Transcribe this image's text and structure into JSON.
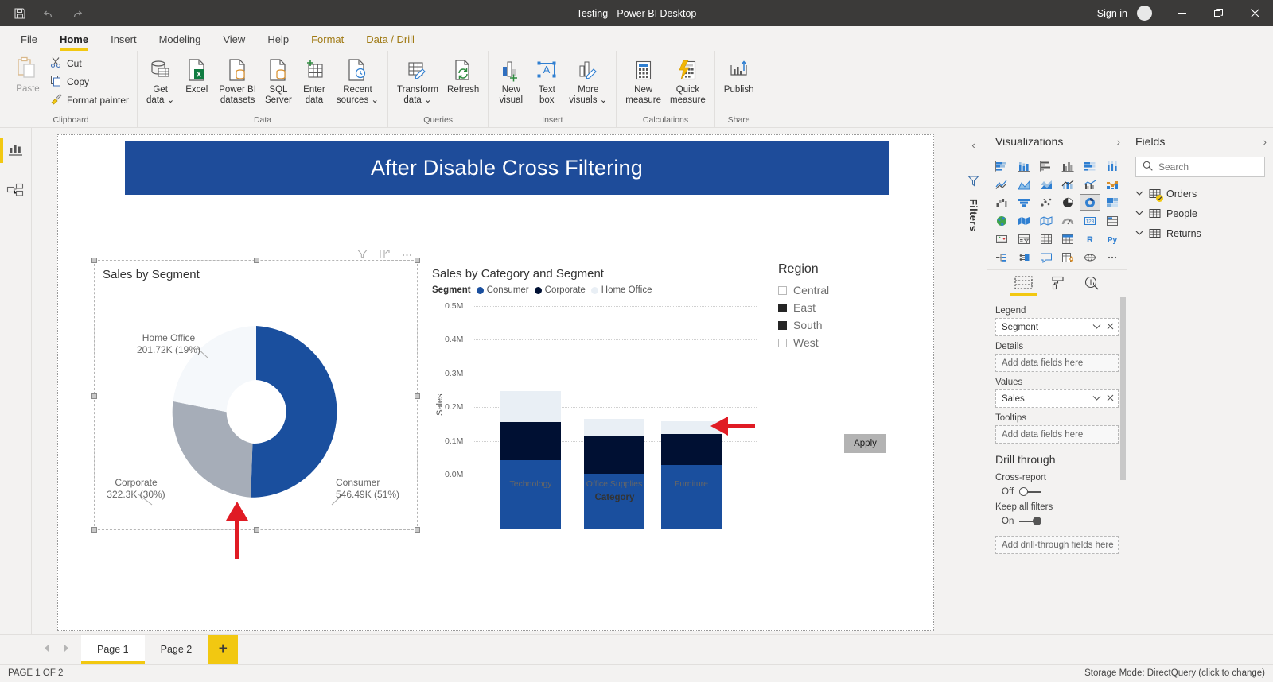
{
  "window": {
    "title": "Testing - Power BI Desktop",
    "signin_label": "Sign in",
    "qat": [
      {
        "name": "save-icon",
        "tooltip": "Save"
      },
      {
        "name": "undo-icon",
        "tooltip": "Undo"
      },
      {
        "name": "redo-icon",
        "tooltip": "Redo"
      }
    ],
    "controls": [
      {
        "name": "minimize-button",
        "glyph": "—"
      },
      {
        "name": "restore-button",
        "glyph": "❐"
      },
      {
        "name": "close-button",
        "glyph": "✕"
      }
    ]
  },
  "ribbon": {
    "tabs": [
      {
        "label": "File",
        "active": false,
        "contextual": false
      },
      {
        "label": "Home",
        "active": true,
        "contextual": false
      },
      {
        "label": "Insert",
        "active": false,
        "contextual": false
      },
      {
        "label": "Modeling",
        "active": false,
        "contextual": false
      },
      {
        "label": "View",
        "active": false,
        "contextual": false
      },
      {
        "label": "Help",
        "active": false,
        "contextual": false
      },
      {
        "label": "Format",
        "active": false,
        "contextual": true
      },
      {
        "label": "Data / Drill",
        "active": false,
        "contextual": true
      }
    ],
    "groups": [
      {
        "label": "Clipboard",
        "paste": "Paste",
        "items": [
          {
            "label": "Cut",
            "icon": "scissors-icon"
          },
          {
            "label": "Copy",
            "icon": "copy-icon"
          },
          {
            "label": "Format painter",
            "icon": "paintbrush-icon"
          }
        ]
      },
      {
        "label": "Data",
        "items": [
          {
            "label": "Get\ndata ⌄",
            "icon": "get-data-icon"
          },
          {
            "label": "Excel",
            "icon": "excel-icon"
          },
          {
            "label": "Power BI\ndatasets",
            "icon": "powerbi-datasets-icon"
          },
          {
            "label": "SQL\nServer",
            "icon": "sql-server-icon"
          },
          {
            "label": "Enter\ndata",
            "icon": "enter-data-icon"
          },
          {
            "label": "Recent\nsources ⌄",
            "icon": "recent-sources-icon"
          }
        ]
      },
      {
        "label": "Queries",
        "items": [
          {
            "label": "Transform\ndata ⌄",
            "icon": "transform-data-icon"
          },
          {
            "label": "Refresh",
            "icon": "refresh-icon"
          }
        ]
      },
      {
        "label": "Insert",
        "items": [
          {
            "label": "New\nvisual",
            "icon": "new-visual-icon"
          },
          {
            "label": "Text\nbox",
            "icon": "text-box-icon"
          },
          {
            "label": "More\nvisuals ⌄",
            "icon": "more-visuals-icon"
          }
        ]
      },
      {
        "label": "Calculations",
        "items": [
          {
            "label": "New\nmeasure",
            "icon": "new-measure-icon"
          },
          {
            "label": "Quick\nmeasure",
            "icon": "quick-measure-icon"
          }
        ]
      },
      {
        "label": "Share",
        "items": [
          {
            "label": "Publish",
            "icon": "publish-icon"
          }
        ]
      }
    ]
  },
  "view_rail": [
    {
      "name": "report-view",
      "icon": "bar-chart-icon",
      "active": true
    },
    {
      "name": "model-view",
      "icon": "model-relationship-icon",
      "active": false
    }
  ],
  "canvas": {
    "banner_title": "After Disable Cross Filtering",
    "banner_color": "#1e4c9a",
    "visual_header_icons": [
      "filter-icon",
      "focus-mode-icon",
      "more-options-icon"
    ]
  },
  "chart_data": [
    {
      "type": "pie",
      "title": "Sales by Segment",
      "selected": true,
      "labels": [
        "Consumer",
        "Corporate",
        "Home Office"
      ],
      "values": [
        546490,
        322300,
        201720
      ],
      "value_labels": [
        "546.49K (51%)",
        "322.3K (30%)",
        "201.72K (19%)"
      ],
      "percentages": [
        51,
        30,
        19
      ],
      "colors": [
        "#1a4f9e",
        "#a6adb8",
        "#f5f8fb"
      ],
      "legend": "none",
      "donut": true
    },
    {
      "type": "bar",
      "subtype": "stacked",
      "title": "Sales by Category and Segment",
      "legend_title": "Segment",
      "categories": [
        "Technology",
        "Office Supplies",
        "Furniture"
      ],
      "series": [
        {
          "name": "Consumer",
          "color": "#1a4f9e",
          "values": [
            203000,
            163000,
            189000
          ]
        },
        {
          "name": "Corporate",
          "color": "#001033",
          "values": [
            112000,
            111000,
            91000
          ]
        },
        {
          "name": "Home Office",
          "color": "#e9eff5",
          "values": [
            93000,
            51000,
            38000
          ]
        }
      ],
      "xlabel": "Category",
      "ylabel": "Sales",
      "ylim": [
        0,
        500000
      ],
      "yticks": [
        "0.0M",
        "0.1M",
        "0.2M",
        "0.3M",
        "0.4M",
        "0.5M"
      ],
      "grid": true,
      "legend_position": "top"
    }
  ],
  "slicer": {
    "title": "Region",
    "items": [
      {
        "label": "Central",
        "checked": false
      },
      {
        "label": "East",
        "checked": true
      },
      {
        "label": "South",
        "checked": true
      },
      {
        "label": "West",
        "checked": false
      }
    ],
    "apply_label": "Apply"
  },
  "filters_pane": {
    "label": "Filters",
    "expand_icon": "chevron-left-icon",
    "funnel_icon": "filter-funnel-icon"
  },
  "visualizations": {
    "title": "Visualizations",
    "collapse_icon": "chevron-left-icon",
    "expand_icon": "chevron-right-icon",
    "icons": [
      "stacked-bar-chart",
      "stacked-column-chart",
      "clustered-bar-chart",
      "clustered-column-chart",
      "100-stacked-bar-chart",
      "100-stacked-column-chart",
      "line-chart",
      "area-chart",
      "stacked-area-chart",
      "line-stacked-column-chart",
      "line-clustered-column-chart",
      "ribbon-chart",
      "waterfall-chart",
      "funnel-chart",
      "scatter-chart",
      "pie-chart",
      "donut-chart",
      "treemap",
      "map",
      "filled-map",
      "shape-map",
      "azure-map",
      "gauge",
      "card",
      "multi-row-card",
      "kpi",
      "slicer",
      "table",
      "matrix",
      "r-script-visual",
      "python-visual",
      "decomposition-tree",
      "key-influencers",
      "smart-narrative",
      "paginated-report",
      "arcgis-map",
      "get-more-visuals"
    ],
    "selected_icon": "donut-chart",
    "tabs": [
      {
        "name": "fields-tab",
        "icon": "fields-table-icon",
        "active": true
      },
      {
        "name": "format-tab",
        "icon": "paint-roller-icon",
        "active": false
      },
      {
        "name": "analytics-tab",
        "icon": "magnifier-chart-icon",
        "active": false
      }
    ],
    "wells": [
      {
        "label": "Legend",
        "value": "Segment",
        "empty": false
      },
      {
        "label": "Details",
        "value": "Add data fields here",
        "empty": true
      },
      {
        "label": "Values",
        "value": "Sales",
        "empty": false
      },
      {
        "label": "Tooltips",
        "value": "Add data fields here",
        "empty": true
      }
    ],
    "drill_through": {
      "title": "Drill through",
      "cross_report_label": "Cross-report",
      "cross_report_state": "Off",
      "keep_filters_label": "Keep all filters",
      "keep_filters_state": "On",
      "drop_zone": "Add drill-through fields here"
    }
  },
  "fields": {
    "title": "Fields",
    "expand_icon": "chevron-right-icon",
    "search_placeholder": "Search",
    "search_value": "",
    "tables": [
      {
        "name": "Orders",
        "badge": true
      },
      {
        "name": "People",
        "badge": false
      },
      {
        "name": "Returns",
        "badge": false
      }
    ]
  },
  "pagebar": {
    "prev_icon": "chevron-left-icon",
    "next_icon": "chevron-right-icon",
    "tabs": [
      {
        "label": "Page 1",
        "active": true
      },
      {
        "label": "Page 2",
        "active": false
      }
    ],
    "add_label": "+"
  },
  "statusbar": {
    "left": "PAGE 1 OF 2",
    "right": "Storage Mode: DirectQuery (click to change)"
  }
}
